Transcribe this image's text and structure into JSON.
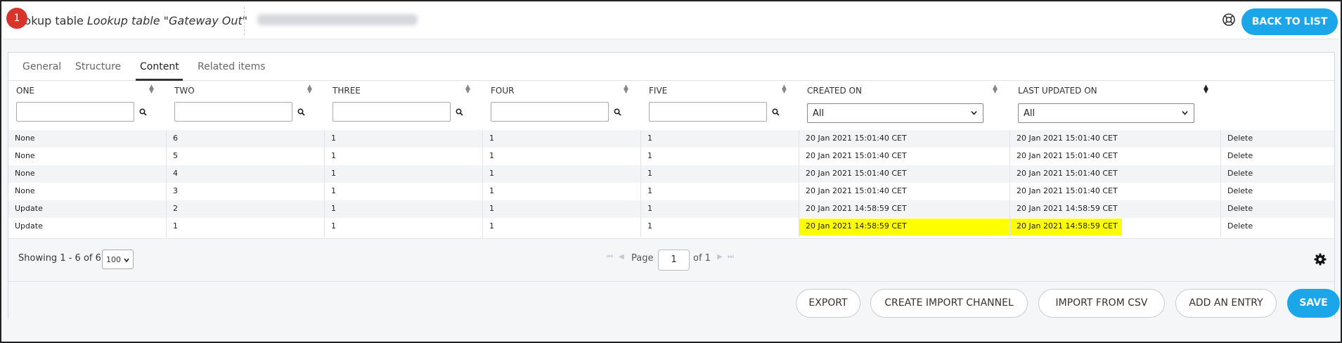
{
  "header": {
    "badge": "1",
    "title": "Lookup table",
    "subtitle": "Lookup table \"Gateway Out\"",
    "back_label": "BACK TO LIST"
  },
  "tabs": [
    "General",
    "Structure",
    "Content",
    "Related items"
  ],
  "active_tab": "Content",
  "columns": [
    "ONE",
    "TWO",
    "THREE",
    "FOUR",
    "FIVE",
    "CREATED ON",
    "LAST UPDATED ON"
  ],
  "date_filter_value": "All",
  "rows": [
    {
      "one": "None",
      "two": "6",
      "three": "1",
      "four": "1",
      "five": "1",
      "created": "20 Jan 2021 15:01:40 CET",
      "updated": "20 Jan 2021 15:01:40 CET",
      "action": "Delete"
    },
    {
      "one": "None",
      "two": "5",
      "three": "1",
      "four": "1",
      "five": "1",
      "created": "20 Jan 2021 15:01:40 CET",
      "updated": "20 Jan 2021 15:01:40 CET",
      "action": "Delete"
    },
    {
      "one": "None",
      "two": "4",
      "three": "1",
      "four": "1",
      "five": "1",
      "created": "20 Jan 2021 15:01:40 CET",
      "updated": "20 Jan 2021 15:01:40 CET",
      "action": "Delete"
    },
    {
      "one": "None",
      "two": "3",
      "three": "1",
      "four": "1",
      "five": "1",
      "created": "20 Jan 2021 15:01:40 CET",
      "updated": "20 Jan 2021 15:01:40 CET",
      "action": "Delete"
    },
    {
      "one": "Update",
      "two": "2",
      "three": "1",
      "four": "1",
      "five": "1",
      "created": "20 Jan 2021 14:58:59 CET",
      "updated": "20 Jan 2021 14:58:59 CET",
      "action": "Delete"
    },
    {
      "one": "Update",
      "two": "1",
      "three": "1",
      "four": "1",
      "five": "1",
      "created": "20 Jan 2021 14:58:59 CET",
      "updated": "20 Jan 2021 14:58:59 CET",
      "action": "Delete"
    }
  ],
  "highlight_color": "#ffff00",
  "accent_color": "#1aa6e8",
  "pagination": {
    "showing": "Showing 1 - 6 of 6",
    "page_size": "100",
    "page_label": "Page",
    "page_value": "1",
    "of_label": "of 1"
  },
  "actions": {
    "export": "EXPORT",
    "create_channel": "CREATE IMPORT CHANNEL",
    "import_csv": "IMPORT FROM CSV",
    "add_entry": "ADD AN ENTRY",
    "save": "SAVE"
  },
  "icons": {
    "help": "lifebuoy-icon",
    "settings": "gear-icon",
    "filter": "search-icon",
    "sort": "sort-icon"
  }
}
